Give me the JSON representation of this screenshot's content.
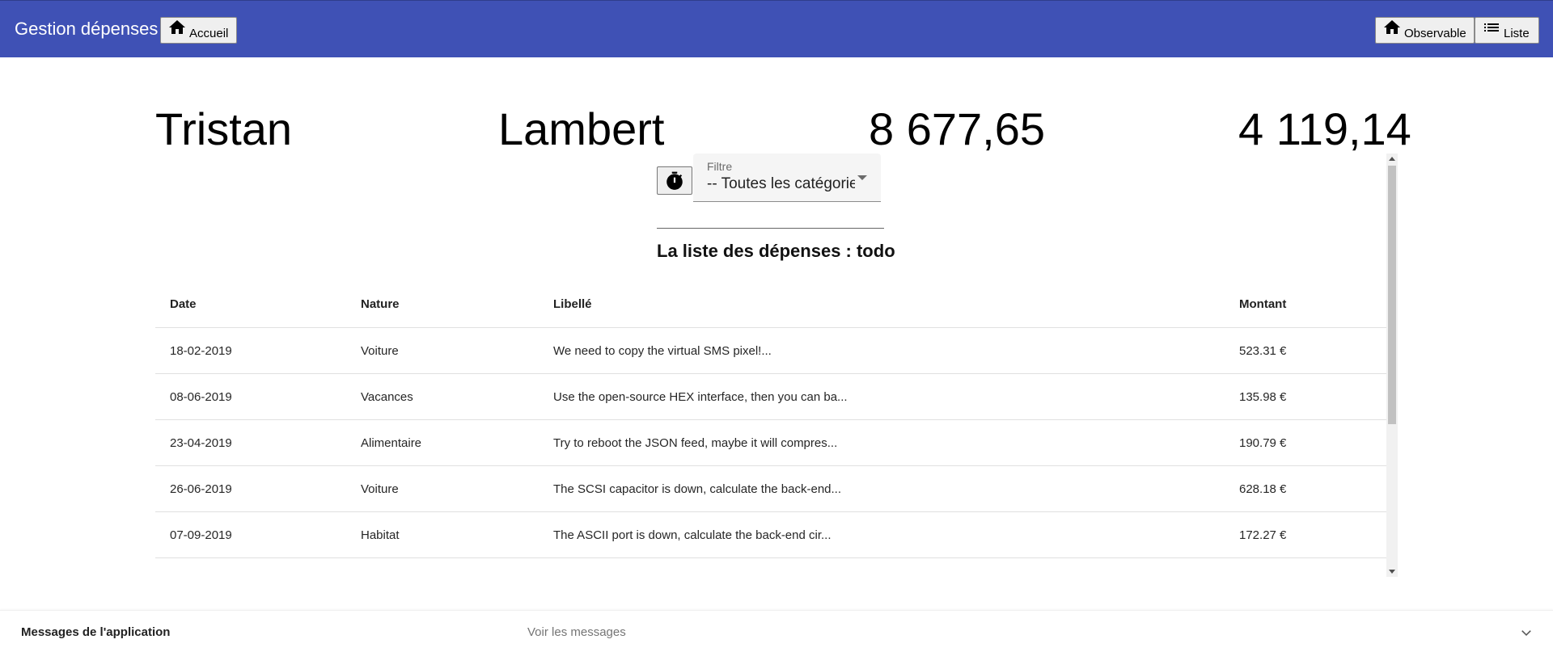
{
  "header": {
    "title": "Gestion dépenses",
    "nav_left": [
      {
        "label": "Accueil",
        "icon": "home-icon"
      }
    ],
    "nav_right": [
      {
        "label": "Observable",
        "icon": "home-icon"
      },
      {
        "label": "Liste",
        "icon": "list-icon"
      }
    ],
    "background_color": "#3f51b5"
  },
  "summary": {
    "first_name": "Tristan",
    "last_name": "Lambert",
    "total": "8 677,65",
    "second_total": "4 119,14"
  },
  "controls": {
    "timer_icon": "timer-icon",
    "filter_label": "Filtre",
    "filter_value": "-- Toutes les catégories --"
  },
  "list": {
    "title": "La liste des dépenses : todo",
    "columns": [
      "Date",
      "Nature",
      "Libellé",
      "Montant"
    ],
    "rows": [
      {
        "date": "18-02-2019",
        "nature": "Voiture",
        "libelle": "We need to copy the virtual SMS pixel!...",
        "montant": "523.31 €"
      },
      {
        "date": "08-06-2019",
        "nature": "Vacances",
        "libelle": "Use the open-source HEX interface, then you can ba...",
        "montant": "135.98 €"
      },
      {
        "date": "23-04-2019",
        "nature": "Alimentaire",
        "libelle": "Try to reboot the JSON feed, maybe it will compres...",
        "montant": "190.79 €"
      },
      {
        "date": "26-06-2019",
        "nature": "Voiture",
        "libelle": "The SCSI capacitor is down, calculate the back-end...",
        "montant": "628.18 €"
      },
      {
        "date": "07-09-2019",
        "nature": "Habitat",
        "libelle": "The ASCII port is down, calculate the back-end cir...",
        "montant": "172.27 €"
      }
    ]
  },
  "messages": {
    "title": "Messages de l'application",
    "description": "Voir les messages",
    "icon": "chevron-down-icon"
  }
}
